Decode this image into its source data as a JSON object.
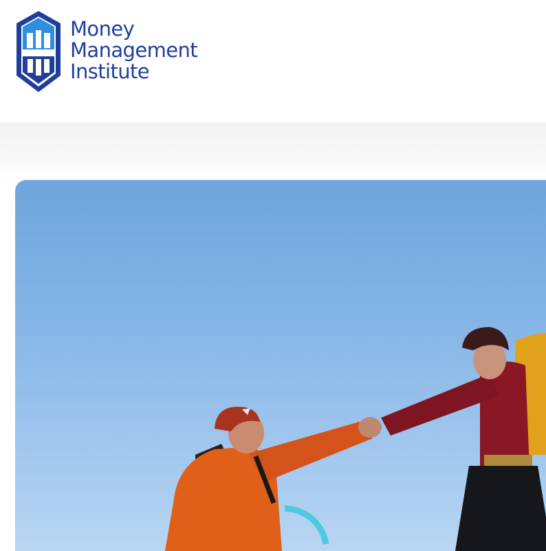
{
  "brand": {
    "name_line1": "Money",
    "name_line2": "Management",
    "name_line3": "Institute",
    "color": "#1f3f9a"
  },
  "hero": {
    "image": "two-hikers-helping-hand-photo",
    "sky_color": "#86b6e6"
  }
}
